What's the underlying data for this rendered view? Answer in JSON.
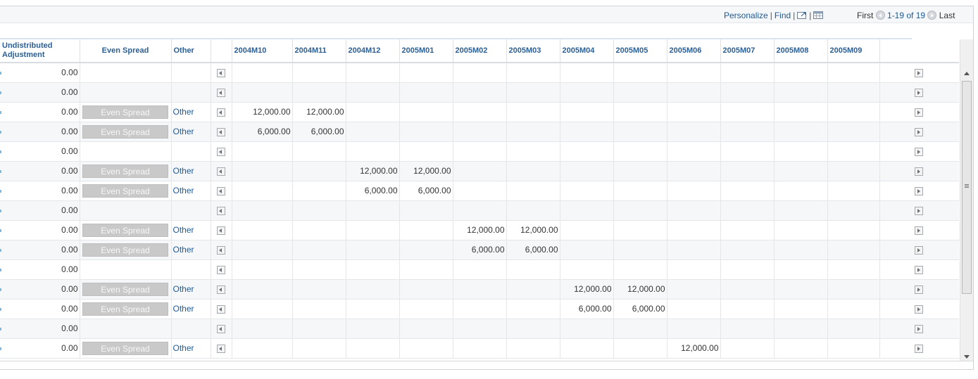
{
  "nav": {
    "personalize": "Personalize",
    "separator": "|",
    "find": "Find",
    "first": "First",
    "range": "1-19 of 19",
    "last": "Last"
  },
  "columns": {
    "undistributed": "Undistributed Adjustment",
    "even_spread": "Even Spread",
    "other": "Other",
    "periods": [
      "2004M10",
      "2004M11",
      "2004M12",
      "2005M01",
      "2005M02",
      "2005M03",
      "2005M04",
      "2005M05",
      "2005M06",
      "2005M07",
      "2005M08",
      "2005M09"
    ]
  },
  "labels": {
    "even_spread_button": "Even Spread",
    "other_link": "Other"
  },
  "rows": [
    {
      "adj": "0.00",
      "actions": false,
      "values": [
        "",
        "",
        "",
        "",
        "",
        "",
        "",
        "",
        "",
        "",
        "",
        ""
      ]
    },
    {
      "adj": "0.00",
      "actions": false,
      "values": [
        "",
        "",
        "",
        "",
        "",
        "",
        "",
        "",
        "",
        "",
        "",
        ""
      ]
    },
    {
      "adj": "0.00",
      "actions": true,
      "values": [
        "12,000.00",
        "12,000.00",
        "",
        "",
        "",
        "",
        "",
        "",
        "",
        "",
        "",
        ""
      ]
    },
    {
      "adj": "0.00",
      "actions": true,
      "values": [
        "6,000.00",
        "6,000.00",
        "",
        "",
        "",
        "",
        "",
        "",
        "",
        "",
        "",
        ""
      ]
    },
    {
      "adj": "0.00",
      "actions": false,
      "values": [
        "",
        "",
        "",
        "",
        "",
        "",
        "",
        "",
        "",
        "",
        "",
        ""
      ]
    },
    {
      "adj": "0.00",
      "actions": true,
      "values": [
        "",
        "",
        "12,000.00",
        "12,000.00",
        "",
        "",
        "",
        "",
        "",
        "",
        "",
        ""
      ]
    },
    {
      "adj": "0.00",
      "actions": true,
      "values": [
        "",
        "",
        "6,000.00",
        "6,000.00",
        "",
        "",
        "",
        "",
        "",
        "",
        "",
        ""
      ]
    },
    {
      "adj": "0.00",
      "actions": false,
      "values": [
        "",
        "",
        "",
        "",
        "",
        "",
        "",
        "",
        "",
        "",
        "",
        ""
      ]
    },
    {
      "adj": "0.00",
      "actions": true,
      "values": [
        "",
        "",
        "",
        "",
        "12,000.00",
        "12,000.00",
        "",
        "",
        "",
        "",
        "",
        ""
      ]
    },
    {
      "adj": "0.00",
      "actions": true,
      "values": [
        "",
        "",
        "",
        "",
        "6,000.00",
        "6,000.00",
        "",
        "",
        "",
        "",
        "",
        ""
      ]
    },
    {
      "adj": "0.00",
      "actions": false,
      "values": [
        "",
        "",
        "",
        "",
        "",
        "",
        "",
        "",
        "",
        "",
        "",
        ""
      ]
    },
    {
      "adj": "0.00",
      "actions": true,
      "values": [
        "",
        "",
        "",
        "",
        "",
        "",
        "12,000.00",
        "12,000.00",
        "",
        "",
        "",
        ""
      ]
    },
    {
      "adj": "0.00",
      "actions": true,
      "values": [
        "",
        "",
        "",
        "",
        "",
        "",
        "6,000.00",
        "6,000.00",
        "",
        "",
        "",
        ""
      ]
    },
    {
      "adj": "0.00",
      "actions": false,
      "values": [
        "",
        "",
        "",
        "",
        "",
        "",
        "",
        "",
        "",
        "",
        "",
        ""
      ]
    },
    {
      "adj": "0.00",
      "actions": true,
      "values": [
        "",
        "",
        "",
        "",
        "",
        "",
        "",
        "",
        "12,000.00",
        "",
        "",
        ""
      ]
    }
  ],
  "colors": {
    "link": "#1e5a96",
    "header_text": "#2b5f95",
    "button_disabled_bg": "#c9c9c9",
    "alt_row_bg": "#f6f7f8"
  },
  "icons": {
    "zoom": "new-window-icon",
    "download": "spreadsheet-download-icon",
    "prev": "previous-arrow-icon",
    "next": "next-arrow-icon",
    "scroll_left": "scroll-left-icon",
    "scroll_right": "scroll-right-icon"
  }
}
